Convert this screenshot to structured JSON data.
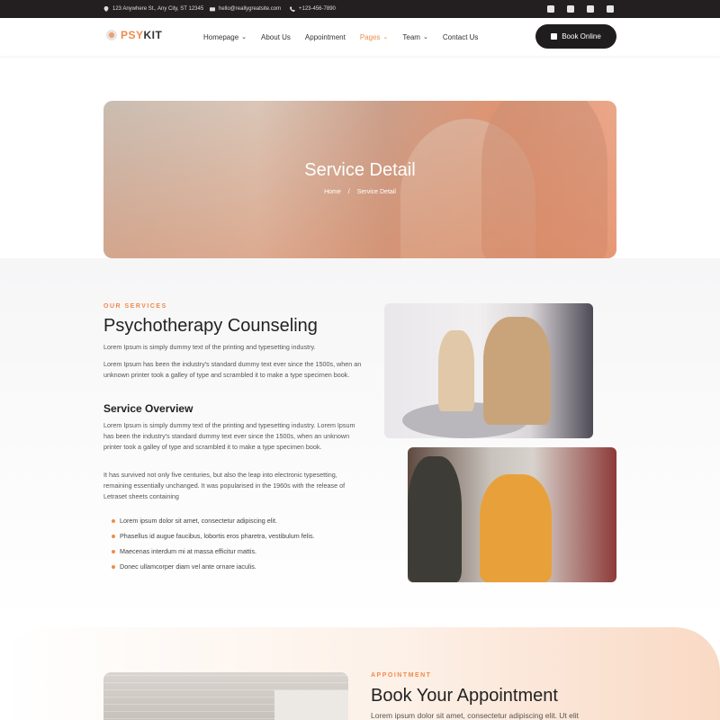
{
  "topbar": {
    "address": "123 Anywhere St., Any City, ST 12345",
    "email": "hello@reallygreatsite.com",
    "phone": "+123-456-7890",
    "socials": [
      "facebook-icon",
      "instagram-icon",
      "twitter-icon",
      "youtube-icon"
    ]
  },
  "header": {
    "logo_prefix": "PSY",
    "logo_suffix": "KIT",
    "nav": [
      {
        "label": "Homepage",
        "has_dropdown": true
      },
      {
        "label": "About Us",
        "has_dropdown": false
      },
      {
        "label": "Appointment",
        "has_dropdown": false
      },
      {
        "label": "Pages",
        "has_dropdown": true,
        "active": true
      },
      {
        "label": "Team",
        "has_dropdown": true
      },
      {
        "label": "Contact Us",
        "has_dropdown": false
      }
    ],
    "cta": "Book Online"
  },
  "hero": {
    "title": "Service Detail",
    "breadcrumb_home": "Home",
    "breadcrumb_current": "Service Detail"
  },
  "service": {
    "eyebrow": "OUR SERVICES",
    "title": "Psychotherapy Counseling",
    "p1": "Lorem Ipsum is simply dummy text of the printing and typesetting industry.",
    "p2": "Lorem Ipsum has been the industry's standard dummy text ever since the 1500s, when an unknown printer took a galley of type and scrambled it to make a type specimen book.",
    "overview_title": "Service Overview",
    "p3": "Lorem Ipsum is simply dummy text of the printing and typesetting industry. Lorem Ipsum has been the industry's standard dummy text ever since the 1500s, when an unknown printer took a galley of type and scrambled it to make a type specimen book.",
    "p4": "It has survived not only five centuries, but also the leap into electronic typesetting, remaining essentially unchanged. It was popularised in the 1960s with the release of Letraset sheets containing",
    "bullets": [
      "Lorem ipsum dolor sit amet, consectetur adipiscing elit.",
      "Phasellus id augue faucibus, lobortis eros pharetra, vestibulum felis.",
      "Maecenas interdum mi at massa efficitur mattis.",
      "Donec ullamcorper diam vel ante ornare iaculis."
    ]
  },
  "appointment": {
    "eyebrow": "APPOINTMENT",
    "title": "Book Your Appointment",
    "text": "Lorem ipsum dolor sit amet, consectetur adipiscing elit. Ut elit"
  },
  "colors": {
    "accent": "#f08a4b",
    "dark": "#231f20"
  }
}
